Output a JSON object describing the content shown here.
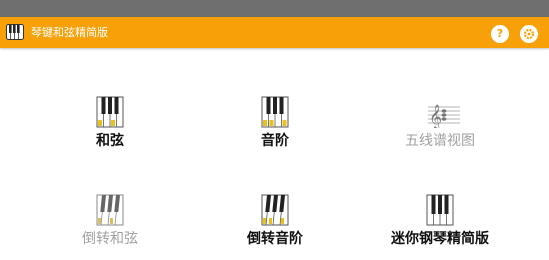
{
  "app_bar": {
    "title": "琴键和弦精简版",
    "icon": "piano-keys-icon",
    "help_label": "?",
    "settings_icon": "gear-icon",
    "accent_color": "#f7a008",
    "status_bar_color": "#6f6f6f"
  },
  "menu": [
    {
      "label": "和弦",
      "icon": "piano-keys-icon",
      "enabled": true
    },
    {
      "label": "音阶",
      "icon": "piano-keys-icon",
      "enabled": true
    },
    {
      "label": "五线谱视图",
      "icon": "treble-clef-icon",
      "enabled": false
    },
    {
      "label": "倒转和弦",
      "icon": "slanted-piano-keys-icon",
      "enabled": false
    },
    {
      "label": "倒转音阶",
      "icon": "slanted-piano-keys-icon",
      "enabled": true
    },
    {
      "label": "迷你钢琴精简版",
      "icon": "piano-keys-icon",
      "enabled": true
    }
  ]
}
